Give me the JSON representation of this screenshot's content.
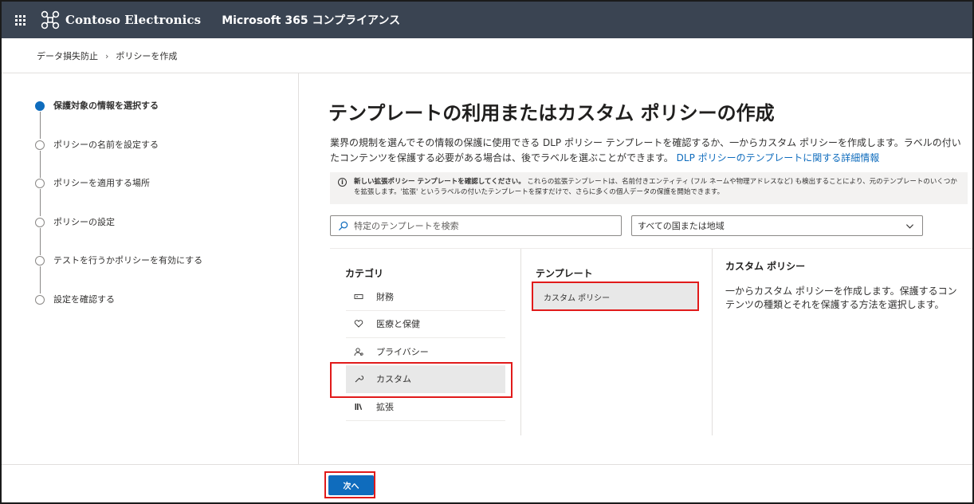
{
  "header": {
    "brand": "Contoso Electronics",
    "product": "Microsoft 365 コンプライアンス"
  },
  "breadcrumb": {
    "parent": "データ損失防止",
    "separator": "›",
    "current": "ポリシーを作成"
  },
  "steps": [
    {
      "label": "保護対象の情報を選択する",
      "state": "active"
    },
    {
      "label": "ポリシーの名前を設定する",
      "state": "pending"
    },
    {
      "label": "ポリシーを適用する場所",
      "state": "pending"
    },
    {
      "label": "ポリシーの設定",
      "state": "pending"
    },
    {
      "label": "テストを行うかポリシーを有効にする",
      "state": "pending"
    },
    {
      "label": "設定を確認する",
      "state": "pending"
    }
  ],
  "main": {
    "title": "テンプレートの利用またはカスタム ポリシーの作成",
    "description": "業界の規制を選んでその情報の保護に使用できる DLP ポリシー テンプレートを確認するか、一からカスタム ポリシーを作成します。ラベルの付いたコンテンツを保護する必要がある場合は、後でラベルを選ぶことができます。",
    "description_link": "DLP ポリシーのテンプレートに関する詳細情報",
    "info_bold": "新しい拡張ポリシー テンプレートを確認してください。",
    "info_text": "これらの拡張テンプレートは、名前付きエンティティ (フル ネームや物理アドレスなど) も検出することにより、元のテンプレートのいくつかを拡張します。'拡張' というラベルの付いたテンプレートを探すだけで、さらに多くの個人データの保護を開始できます。",
    "search_placeholder": "特定のテンプレートを検索",
    "country_select": "すべての国または地域"
  },
  "categories": {
    "heading": "カテゴリ",
    "items": [
      {
        "label": "財務",
        "icon": "money-icon",
        "selected": false
      },
      {
        "label": "医療と保健",
        "icon": "heart-icon",
        "selected": false
      },
      {
        "label": "プライバシー",
        "icon": "person-icon",
        "selected": false
      },
      {
        "label": "カスタム",
        "icon": "wrench-icon",
        "selected": true
      },
      {
        "label": "拡張",
        "icon": "library-icon",
        "selected": false
      }
    ]
  },
  "templates": {
    "heading": "テンプレート",
    "items": [
      {
        "label": "カスタム ポリシー",
        "selected": true
      }
    ]
  },
  "details": {
    "heading": "カスタム ポリシー",
    "body": "一からカスタム ポリシーを作成します。保護するコンテンツの種類とそれを保護する方法を選択します。"
  },
  "footer": {
    "next_label": "次へ"
  },
  "colors": {
    "header_bg": "#3a4452",
    "accent": "#0f6cbd",
    "highlight_box": "#e11a1a",
    "selected_bg": "#e8e8e8"
  }
}
